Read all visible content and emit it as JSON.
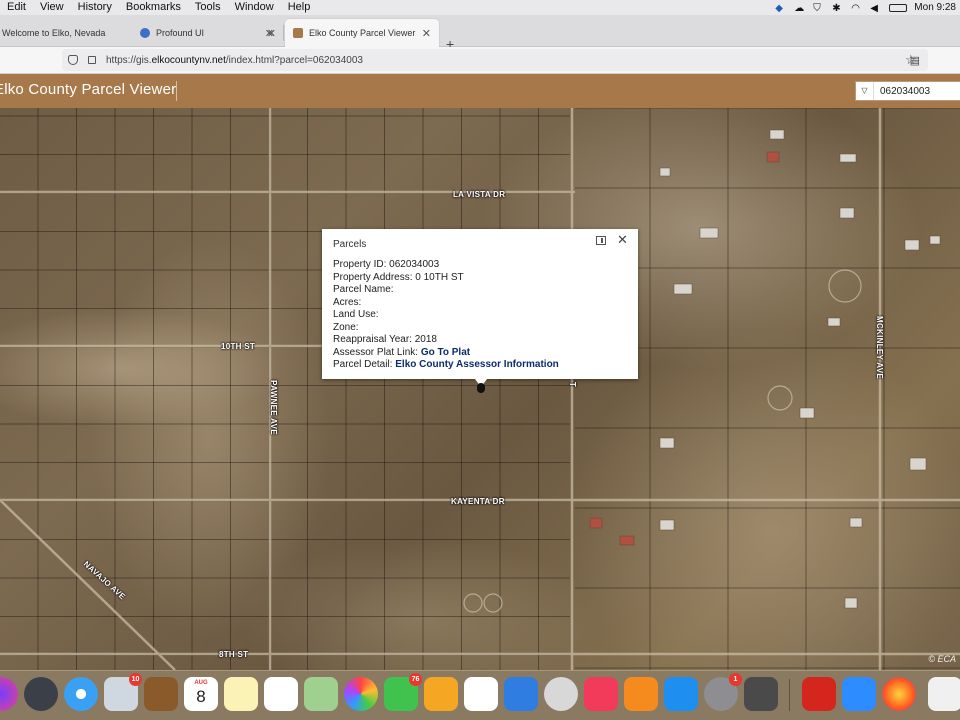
{
  "menubar": {
    "items": [
      "Edit",
      "View",
      "History",
      "Bookmarks",
      "Tools",
      "Window",
      "Help"
    ],
    "clock": "Mon 9:28"
  },
  "tabs": [
    {
      "label": "Welcome to Elko, Nevada"
    },
    {
      "label": "Profound UI"
    },
    {
      "label": "Elko County Parcel Viewer"
    }
  ],
  "urlbar": {
    "url_prefix": "https://gis.",
    "url_domain": "elkocountynv.net",
    "url_path": "/index.html?parcel=062034003"
  },
  "app": {
    "title": "Elko County Parcel Viewer",
    "search_value": "062034003"
  },
  "map": {
    "roads": {
      "la_vista": "LA VISTA DR",
      "tenth": "10TH ST",
      "pawnee": "PAWNEE AVE",
      "kayenta": "KAYENTA DR",
      "navajo": "NAVAJO AVE",
      "eighth": "8TH ST",
      "mckinley": "MCKINLEY AVE",
      "t_label": "T"
    },
    "attribution": "© ECA"
  },
  "popup": {
    "title": "Parcels",
    "property_id": "Property ID: 062034003",
    "property_address": "Property Address: 0 10TH ST",
    "parcel_name": "Parcel Name:",
    "acres": "Acres:",
    "land_use": "Land Use:",
    "zone": "Zone:",
    "reappraisal": "Reappraisal Year: 2018",
    "plat_label": "Assessor Plat Link:",
    "plat_link": "Go To Plat",
    "detail_label": "Parcel Detail:",
    "detail_link": "Elko County Assessor Information"
  },
  "dock": {
    "mail_badge": "10",
    "calendar_month": "AUG",
    "calendar_day": "8",
    "messages_badge": "76",
    "prefs_badge": "1"
  },
  "colors": {
    "header_bg": "#a7784a",
    "link": "#0b2c6e"
  }
}
